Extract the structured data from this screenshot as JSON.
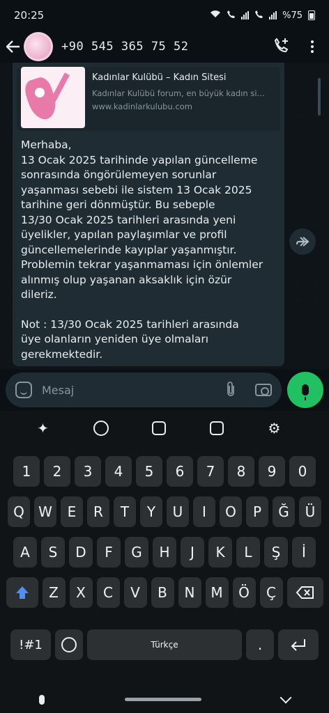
{
  "status": {
    "time": "20:25",
    "battery": "%75"
  },
  "header": {
    "contact": "+90 545 365 75 52"
  },
  "link_preview": {
    "title": "Kadınlar Kulübü – Kadın Sitesi",
    "description": "Kadınlar Kulübü forum, en büyük kadın si…",
    "url": "www.kadinlarkulubu.com"
  },
  "message": {
    "paragraph1": "Merhaba,\n13 Ocak 2025 tarihinde yapılan güncelleme\nsonrasında öngörülemeyen sorunlar\nyaşanması sebebi ile sistem 13 Ocak 2025\ntarihine geri dönmüştür. Bu sebeple\n13/30 Ocak 2025 tarihleri arasında yeni\nüyelikler, yapılan paylaşımlar ve profil\ngüncellemelerinde kayıplar yaşanmıştır.\nProblemin tekrar yaşanmaması için önlemler\nalınmış olup yaşanan aksaklık için özür\ndileriz.",
    "paragraph2": "Not : 13/30 Ocak 2025 tarihleri arasında\nüye olanların yeniden üye olmaları\ngerekmektedir."
  },
  "composer": {
    "placeholder": "Mesaj"
  },
  "keyboard": {
    "row_numbers": [
      "1",
      "2",
      "3",
      "4",
      "5",
      "6",
      "7",
      "8",
      "9",
      "0"
    ],
    "row1": [
      "Q",
      "W",
      "E",
      "R",
      "T",
      "Y",
      "U",
      "I",
      "O",
      "P",
      "Ğ",
      "Ü"
    ],
    "row2": [
      "A",
      "S",
      "D",
      "F",
      "G",
      "H",
      "J",
      "K",
      "L",
      "Ş",
      "İ"
    ],
    "row3": [
      "Z",
      "X",
      "C",
      "V",
      "B",
      "N",
      "M",
      "Ö",
      "Ç"
    ],
    "symbols_label": "!#1",
    "space_label": "Türkçe",
    "period_label": "."
  }
}
